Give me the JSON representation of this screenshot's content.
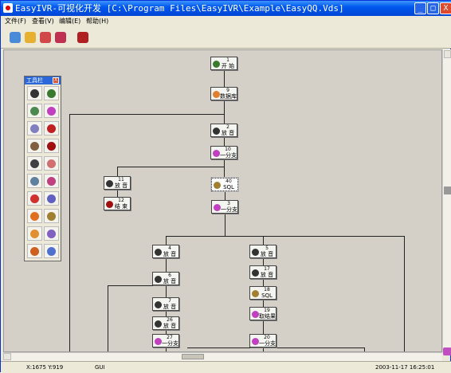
{
  "window": {
    "title": "EasyIVR-可视化开发 [C:\\Program Files\\EasyIVR\\Example\\EasyQQ.Vds]",
    "buttons": {
      "minimize": "_",
      "maximize": "□",
      "close": "X"
    }
  },
  "menu": [
    {
      "label": "文件(F)"
    },
    {
      "label": "查看(V)"
    },
    {
      "label": "编辑(E)"
    },
    {
      "label": "帮助(H)"
    }
  ],
  "toolbar": {
    "buttons": [
      {
        "name": "new-icon",
        "color": "#4A8BD8"
      },
      {
        "name": "open-icon",
        "color": "#E8B030"
      },
      {
        "name": "save-icon",
        "color": "#D04848"
      },
      {
        "name": "run-icon",
        "color": "#C03050"
      },
      {
        "name": "delete-icon",
        "color": "#B02020"
      }
    ]
  },
  "palette": {
    "title": "工具栏",
    "close_label": "X",
    "items": [
      {
        "name": "pointer-icon",
        "color": "#333333"
      },
      {
        "name": "start-icon",
        "color": "#3A7A30"
      },
      {
        "name": "phone-icon",
        "color": "#4A8A50"
      },
      {
        "name": "branch-icon",
        "color": "#C040C0"
      },
      {
        "name": "dial-icon",
        "color": "#8080C0"
      },
      {
        "name": "stop-icon",
        "color": "#C02020"
      },
      {
        "name": "person-icon",
        "color": "#806040"
      },
      {
        "name": "end-icon",
        "color": "#A01010"
      },
      {
        "name": "play-icon",
        "color": "#404040"
      },
      {
        "name": "record-icon",
        "color": "#D07070"
      },
      {
        "name": "dtmf-icon",
        "color": "#6080A0"
      },
      {
        "name": "music-icon",
        "color": "#C04080"
      },
      {
        "name": "noentry-icon",
        "color": "#D03030"
      },
      {
        "name": "transfer-icon",
        "color": "#6060C0"
      },
      {
        "name": "fire-icon",
        "color": "#E07020"
      },
      {
        "name": "sql-icon",
        "color": "#A08030"
      },
      {
        "name": "database-icon",
        "color": "#E09030"
      },
      {
        "name": "compare-icon",
        "color": "#8060C0"
      },
      {
        "name": "var-icon",
        "color": "#D06020"
      },
      {
        "name": "globe-icon",
        "color": "#5070D0"
      }
    ]
  },
  "nodes": [
    {
      "id": "1",
      "label": "开 始",
      "icon": "start-icon",
      "color": "#3A7A30"
    },
    {
      "id": "9",
      "label": "数据库",
      "icon": "database-icon",
      "color": "#E08030"
    },
    {
      "id": "2",
      "label": "放 音",
      "icon": "play-icon",
      "color": "#333333"
    },
    {
      "id": "10",
      "label": "一分支",
      "icon": "branch-icon",
      "color": "#C040C0"
    },
    {
      "id": "11",
      "label": "放 音",
      "icon": "play-icon",
      "color": "#333333"
    },
    {
      "id": "40",
      "label": "SQL",
      "icon": "sql-icon",
      "color": "#A08030"
    },
    {
      "id": "12",
      "label": "结 束",
      "icon": "end-icon",
      "color": "#A01010"
    },
    {
      "id": "3",
      "label": "一分支",
      "icon": "branch-icon",
      "color": "#C040C0"
    },
    {
      "id": "4",
      "label": "放 音",
      "icon": "play-icon",
      "color": "#333333"
    },
    {
      "id": "5",
      "label": "放 音",
      "icon": "play-icon",
      "color": "#333333"
    },
    {
      "id": "6",
      "label": "放 音",
      "icon": "play-icon",
      "color": "#333333"
    },
    {
      "id": "17",
      "label": "放 音",
      "icon": "play-icon",
      "color": "#333333"
    },
    {
      "id": "18",
      "label": "SQL",
      "icon": "sql-icon",
      "color": "#A08030"
    },
    {
      "id": "7",
      "label": "放 音",
      "icon": "play-icon",
      "color": "#333333"
    },
    {
      "id": "19",
      "label": "取结果",
      "icon": "result-icon",
      "color": "#C040C0"
    },
    {
      "id": "26",
      "label": "放 音",
      "icon": "play-icon",
      "color": "#333333"
    },
    {
      "id": "27",
      "label": "一分支",
      "icon": "branch-icon",
      "color": "#C040C0"
    },
    {
      "id": "20",
      "label": "一分支",
      "icon": "branch-icon",
      "color": "#C040C0"
    }
  ],
  "status": {
    "coords": "X:1675 Y:919",
    "mode": "GUI",
    "datetime": "2003-11-17 16:25:01"
  }
}
